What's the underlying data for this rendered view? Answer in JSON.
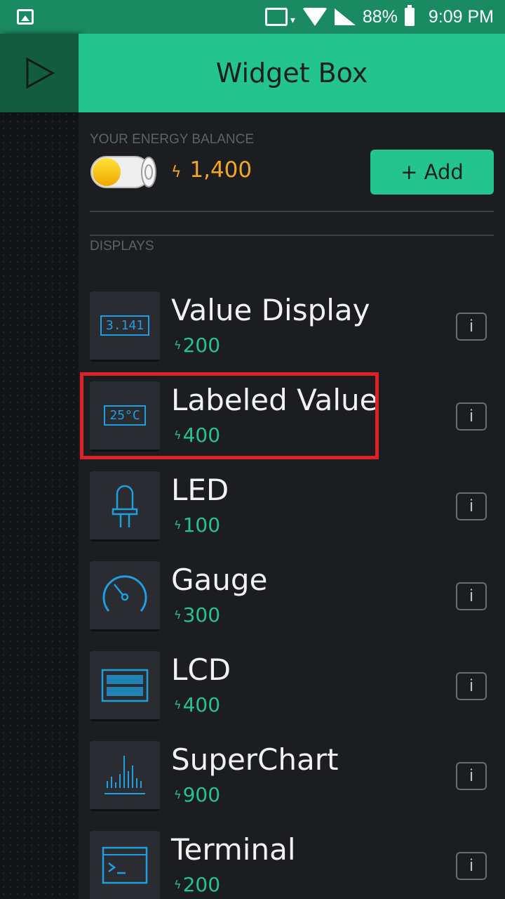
{
  "status_bar": {
    "battery_percent": "88%",
    "time": "9:09 PM"
  },
  "header": {
    "title": "Widget Box"
  },
  "energy": {
    "label": "YOUR ENERGY BALANCE",
    "value": "1,400",
    "add_label": "+ Add"
  },
  "section": {
    "displays_label": "DISPLAYS"
  },
  "widgets": [
    {
      "name": "Value Display",
      "cost": "200",
      "icon_text": "3.141",
      "icon": "value-display-icon"
    },
    {
      "name": "Labeled Value",
      "cost": "400",
      "icon_text": "25°C",
      "icon": "labeled-value-icon"
    },
    {
      "name": "LED",
      "cost": "100",
      "icon": "led-icon"
    },
    {
      "name": "Gauge",
      "cost": "300",
      "icon": "gauge-icon"
    },
    {
      "name": "LCD",
      "cost": "400",
      "icon": "lcd-icon"
    },
    {
      "name": "SuperChart",
      "cost": "900",
      "icon": "superchart-icon"
    },
    {
      "name": "Terminal",
      "cost": "200",
      "icon": "terminal-icon"
    }
  ],
  "info_label": "i",
  "colors": {
    "accent": "#23c48e",
    "energy": "#f5a623",
    "highlight": "#e02027",
    "icon_blue": "#1f9fe0"
  }
}
